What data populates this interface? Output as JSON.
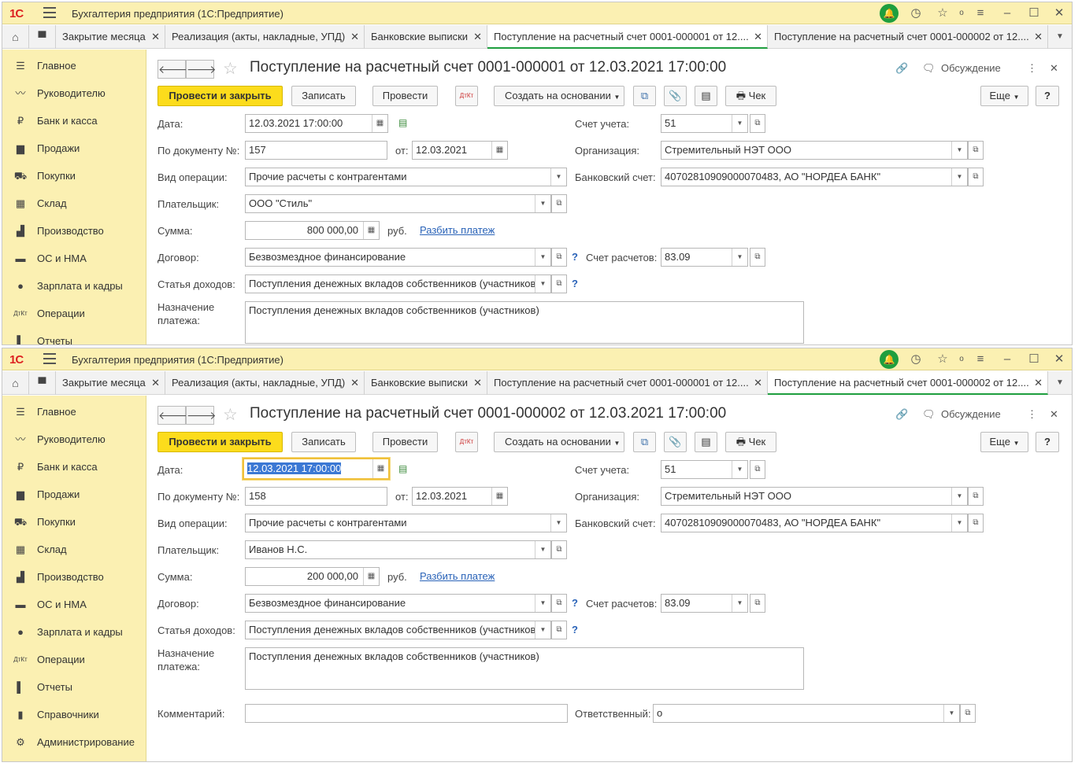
{
  "app": {
    "logo": "1С",
    "title": "Бухгалтерия предприятия (1С:Предприятие)"
  },
  "tabs": [
    {
      "label": "Закрытие месяца"
    },
    {
      "label": "Реализация (акты, накладные, УПД)"
    },
    {
      "label": "Банковские выписки"
    },
    {
      "label": "Поступление на расчетный счет 0001-000001 от 12...."
    },
    {
      "label": "Поступление на расчетный счет 0001-000002 от 12...."
    }
  ],
  "sidebar": [
    {
      "label": "Главное",
      "icon": "list-icon"
    },
    {
      "label": "Руководителю",
      "icon": "trend-icon"
    },
    {
      "label": "Банк и касса",
      "icon": "ruble-icon"
    },
    {
      "label": "Продажи",
      "icon": "bag-icon"
    },
    {
      "label": "Покупки",
      "icon": "cart-icon"
    },
    {
      "label": "Склад",
      "icon": "grid-icon"
    },
    {
      "label": "Производство",
      "icon": "factory-icon"
    },
    {
      "label": "ОС и НМА",
      "icon": "truck-icon"
    },
    {
      "label": "Зарплата и кадры",
      "icon": "person-icon"
    },
    {
      "label": "Операции",
      "icon": "dt-kt-icon"
    },
    {
      "label": "Отчеты",
      "icon": "bar-chart-icon"
    },
    {
      "label": "Справочники",
      "icon": "book-icon"
    },
    {
      "label": "Администрирование",
      "icon": "gear-icon"
    }
  ],
  "toolbar": {
    "post_close": "Провести и закрыть",
    "save": "Записать",
    "post": "Провести",
    "create_basis": "Создать на основании",
    "check": "Чек",
    "more": "Еще",
    "help": "?",
    "discussion": "Обсуждение"
  },
  "labels": {
    "date": "Дата:",
    "doc_no": "По документу №:",
    "from": "от:",
    "op_type": "Вид операции:",
    "payer": "Плательщик:",
    "sum": "Сумма:",
    "rub": "руб.",
    "split": "Разбить платеж",
    "contract": "Договор:",
    "income": "Статья доходов:",
    "purpose1": "Назначение",
    "purpose2": "платежа:",
    "account": "Счет учета:",
    "org": "Организация:",
    "bank_account": "Банковский счет:",
    "settle_account": "Счет расчетов:",
    "comment": "Комментарий:",
    "responsible": "Ответственный:",
    "q": "?"
  },
  "doc1": {
    "title": "Поступление на расчетный счет 0001-000001 от 12.03.2021 17:00:00",
    "date": "12.03.2021 17:00:00",
    "doc_no": "157",
    "doc_date": "12.03.2021",
    "op_type": "Прочие расчеты с контрагентами",
    "payer": "ООО \"Стиль\"",
    "sum": "800 000,00",
    "contract": "Безвозмездное финансирование",
    "income": "Поступления денежных вкладов собственников (участников",
    "purpose": "Поступления денежных вкладов собственников (участников)",
    "account": "51",
    "org": "Стремительный НЭТ ООО",
    "bank_account": "40702810909000070483, АО \"НОРДЕА БАНК\"",
    "settle_account": "83.09"
  },
  "doc2": {
    "title": "Поступление на расчетный счет 0001-000002 от 12.03.2021 17:00:00",
    "date": "12.03.2021 17:00:00",
    "doc_no": "158",
    "doc_date": "12.03.2021",
    "op_type": "Прочие расчеты с контрагентами",
    "payer": "Иванов Н.С.",
    "sum": "200 000,00",
    "contract": "Безвозмездное финансирование",
    "income": "Поступления денежных вкладов собственников (участников",
    "purpose": "Поступления денежных вкладов собственников (участников)",
    "account": "51",
    "org": "Стремительный НЭТ ООО",
    "bank_account": "40702810909000070483, АО \"НОРДЕА БАНК\"",
    "settle_account": "83.09",
    "comment": "",
    "responsible": "о"
  }
}
